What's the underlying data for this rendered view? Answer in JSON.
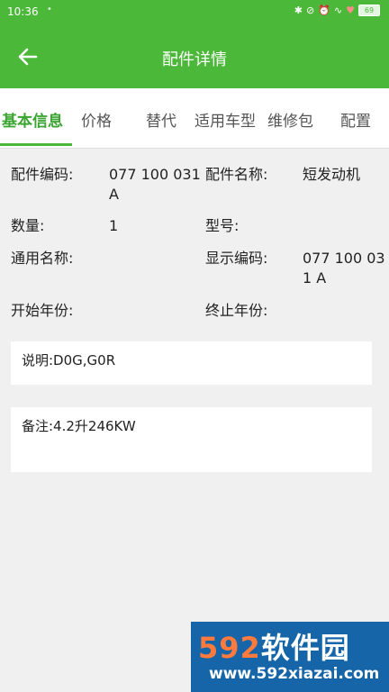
{
  "status_bar": {
    "time": "10:36",
    "battery": "69",
    "icons": [
      "bluetooth-icon",
      "mute-icon",
      "alarm-icon",
      "signal-icon",
      "heart-icon"
    ]
  },
  "app_bar": {
    "title": "配件详情",
    "back_icon": "arrow-left-icon"
  },
  "tabs": [
    {
      "label": "基本信息",
      "active": true
    },
    {
      "label": "价格"
    },
    {
      "label": "替代"
    },
    {
      "label": "适用车型"
    },
    {
      "label": "维修包"
    },
    {
      "label": "配置"
    }
  ],
  "fields": {
    "part_code_label": "配件编码:",
    "part_code_value": "077 100 031 A",
    "part_name_label": "配件名称:",
    "part_name_value": "短发动机",
    "quantity_label": "数量:",
    "quantity_value": "1",
    "model_label": "型号:",
    "model_value": "",
    "common_name_label": "通用名称:",
    "common_name_value": "",
    "display_code_label": "显示编码:",
    "display_code_value": "077 100 031 A",
    "start_year_label": "开始年份:",
    "start_year_value": "",
    "end_year_label": "终止年份:",
    "end_year_value": ""
  },
  "description": "说明:D0G,G0R",
  "remark": "备注:4.2升246KW",
  "watermark": {
    "brand_num": "592",
    "brand_text": "软件园",
    "url": "www.592xiazai.com"
  },
  "colors": {
    "primary_green": "#4cb83a",
    "active_tab": "#3aa430"
  }
}
